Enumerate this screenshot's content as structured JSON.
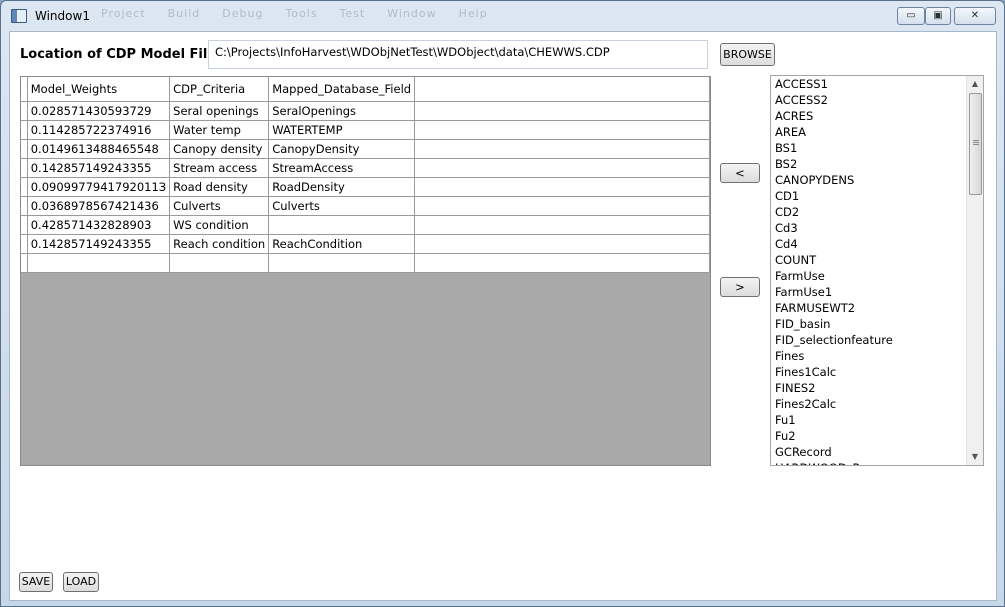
{
  "window": {
    "title": "Window1",
    "ghost_menu": [
      "Project",
      "Build",
      "Debug",
      "Tools",
      "Test",
      "Window",
      "Help"
    ],
    "minimize_label": "▭",
    "maximize_label": "▣",
    "close_label": "✕"
  },
  "file": {
    "label": "Location of CDP Model File",
    "path": "C:\\Projects\\InfoHarvest\\WDObjNetTest\\WDObject\\data\\CHEWWS.CDP",
    "browse_label": "BROWSE"
  },
  "grid": {
    "columns": [
      "Model_Weights",
      "CDP_Criteria",
      "Mapped_Database_Field"
    ],
    "rows": [
      [
        "0.028571430593729",
        "Seral openings",
        "SeralOpenings"
      ],
      [
        "0.114285722374916",
        "Water temp",
        "WATERTEMP"
      ],
      [
        "0.0149613488465548",
        "Canopy density",
        "CanopyDensity"
      ],
      [
        "0.142857149243355",
        "Stream access",
        "StreamAccess"
      ],
      [
        "0.0909977941792011З",
        "Road density",
        "RoadDensity"
      ],
      [
        "0.0368978567421436",
        "Culverts",
        "Culverts"
      ],
      [
        "0.428571432828903",
        "WS condition",
        ""
      ],
      [
        "0.142857149243355",
        "Reach condition",
        "ReachCondition"
      ],
      [
        "",
        "",
        ""
      ]
    ]
  },
  "buttons": {
    "move_left": "<",
    "move_right": ">",
    "save": "SAVE",
    "load": "LOAD"
  },
  "fields": [
    "ACCESS1",
    "ACCESS2",
    "ACRES",
    "AREA",
    "BS1",
    "BS2",
    "CANOPYDENS",
    "CD1",
    "CD2",
    "Cd3",
    "Cd4",
    "COUNT",
    "FarmUse",
    "FarmUse1",
    "FARMUSEWT2",
    "FID_basin",
    "FID_selectionfeature",
    "Fines",
    "Fines1Calc",
    "FINES2",
    "Fines2Calc",
    "Fu1",
    "Fu2",
    "GCRecord",
    "HARDWOOD_P"
  ]
}
